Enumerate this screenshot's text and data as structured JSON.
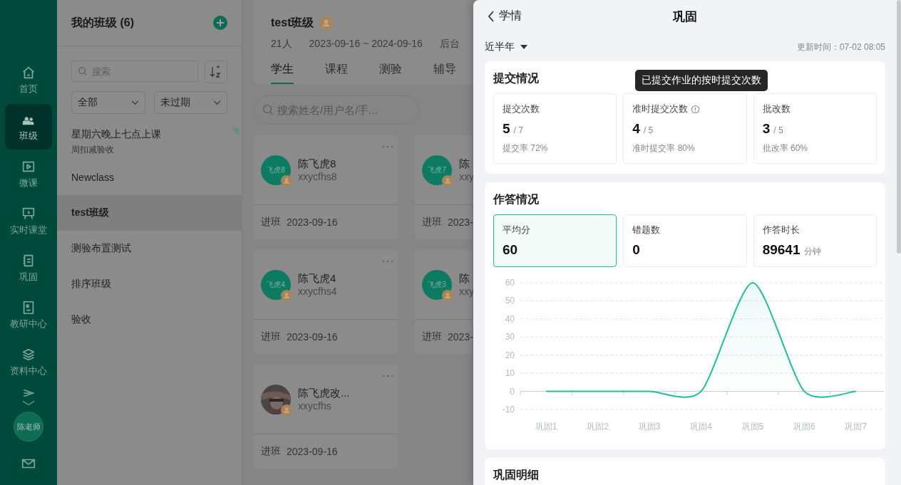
{
  "nav": {
    "items": [
      {
        "label": "首页",
        "selected": false
      },
      {
        "label": "班级",
        "selected": true
      },
      {
        "label": "微课",
        "selected": false
      },
      {
        "label": "实时课堂",
        "selected": false
      },
      {
        "label": "巩固",
        "selected": false
      },
      {
        "label": "教研中心",
        "selected": false
      },
      {
        "label": "资料中心",
        "selected": false
      }
    ],
    "avatar": "陈老师"
  },
  "class_panel": {
    "title": "我的班级 (6)",
    "search_placeholder": "搜索",
    "filters": [
      "全部",
      "未过期"
    ],
    "classes": [
      {
        "name": "星期六晚上七点上课",
        "subtitle": "周扣减验收",
        "selected": false,
        "flagged": true
      },
      {
        "name": "Newclass",
        "selected": false,
        "flagged": false
      },
      {
        "name": "test班级",
        "selected": true,
        "flagged": false
      },
      {
        "name": "测验布置测试",
        "selected": false,
        "flagged": false
      },
      {
        "name": "排序班级",
        "selected": false,
        "flagged": false
      },
      {
        "name": "验收",
        "selected": false,
        "flagged": false
      }
    ]
  },
  "class_header": {
    "name": "test班级",
    "count": "21人",
    "dates": "2023-09-16 ~ 2024-09-16",
    "extra": "后台",
    "tabs": [
      {
        "label": "学生",
        "selected": true
      },
      {
        "label": "课程",
        "selected": false
      },
      {
        "label": "测验",
        "selected": false
      },
      {
        "label": "辅导",
        "selected": false
      }
    ]
  },
  "student_search": {
    "placeholder": "搜索姓名/用户名/手..."
  },
  "students": [
    {
      "kind": "initials",
      "avatar": "飞虎8",
      "name": "陈飞虎8",
      "username": "xxycfhs8",
      "joined_label": "进班",
      "joined_date": "2023-09-16"
    },
    {
      "kind": "initials",
      "avatar": "飞虎7",
      "name": "陈",
      "username": "xxy",
      "joined_label": "进班",
      "joined_date": "2023-"
    },
    {
      "kind": "initials",
      "avatar": "飞虎4",
      "name": "陈飞虎4",
      "username": "xxycfhs4",
      "joined_label": "进班",
      "joined_date": "2023-09-16"
    },
    {
      "kind": "initials",
      "avatar": "飞虎3",
      "name": "陈",
      "username": "xxy",
      "joined_label": "进班",
      "joined_date": "2023-"
    },
    {
      "kind": "picture",
      "name": "陈飞虎改...",
      "username": "xxycfhs",
      "joined_label": "进班",
      "joined_date": "2023-09-16"
    }
  ],
  "drawer": {
    "back": "学情",
    "title": "巩固",
    "period": "近半年",
    "updated": "更新时间：07-02 08:05",
    "submission": {
      "title": "提交情况",
      "tooltip": "已提交作业的按时提交次数",
      "stats": [
        {
          "label": "提交次数",
          "value": "5",
          "total": "/ 7",
          "note": "提交率 72%",
          "info": false
        },
        {
          "label": "准时提交次数",
          "value": "4",
          "total": "/ 5",
          "note": "准时提交率 80%",
          "info": true
        },
        {
          "label": "批改数",
          "value": "3",
          "total": "/ 5",
          "note": "批改率 60%",
          "info": false
        }
      ]
    },
    "answers": {
      "title": "作答情况",
      "stats": [
        {
          "label": "平均分",
          "value": "60",
          "selected": true
        },
        {
          "label": "错题数",
          "value": "0",
          "selected": false
        },
        {
          "label": "作答时长",
          "value": "89641",
          "unit": "分钟",
          "selected": false
        }
      ],
      "chart_data": {
        "type": "area",
        "categories": [
          "巩固1",
          "巩固2",
          "巩固3",
          "巩固4",
          "巩固5",
          "巩固6",
          "巩固7"
        ],
        "series": [
          {
            "color": "#1dbf99",
            "values": [
              0,
              0,
              0,
              0,
              60,
              0,
              0
            ]
          }
        ],
        "grid": true,
        "ylim": [
          -10,
          60
        ],
        "yticks": [
          -10,
          0,
          10,
          20,
          30,
          40,
          50,
          60
        ]
      }
    },
    "details": {
      "title": "巩固明细"
    }
  }
}
